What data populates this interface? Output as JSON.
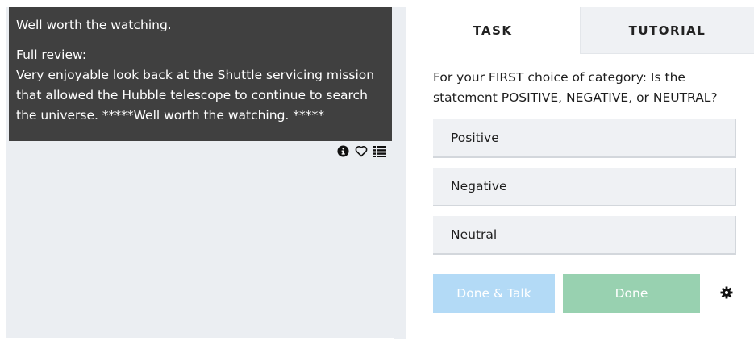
{
  "subject": {
    "title": "Well worth the watching.",
    "review_label": "Full review:",
    "review_text": "Very enjoyable look back at the Shuttle servicing mission that allowed the Hubble telescope to continue to search the universe.  *****Well worth the watching. *****",
    "icons": [
      "info-icon",
      "heart-icon",
      "list-icon"
    ]
  },
  "tabs": [
    {
      "label": "TASK",
      "active": true
    },
    {
      "label": "TUTORIAL",
      "active": false
    }
  ],
  "task": {
    "question": "For your FIRST choice of category: Is the statement POSITIVE, NEGATIVE, or NEUTRAL?",
    "answers": [
      "Positive",
      "Negative",
      "Neutral"
    ]
  },
  "buttons": {
    "done_talk": "Done & Talk",
    "done": "Done",
    "settings_icon": "gear-icon"
  },
  "colors": {
    "subject_bg": "#404040",
    "done_talk_bg": "#b3daf6",
    "done_bg": "#98d1b0",
    "pane_bg": "#ebeef2"
  }
}
